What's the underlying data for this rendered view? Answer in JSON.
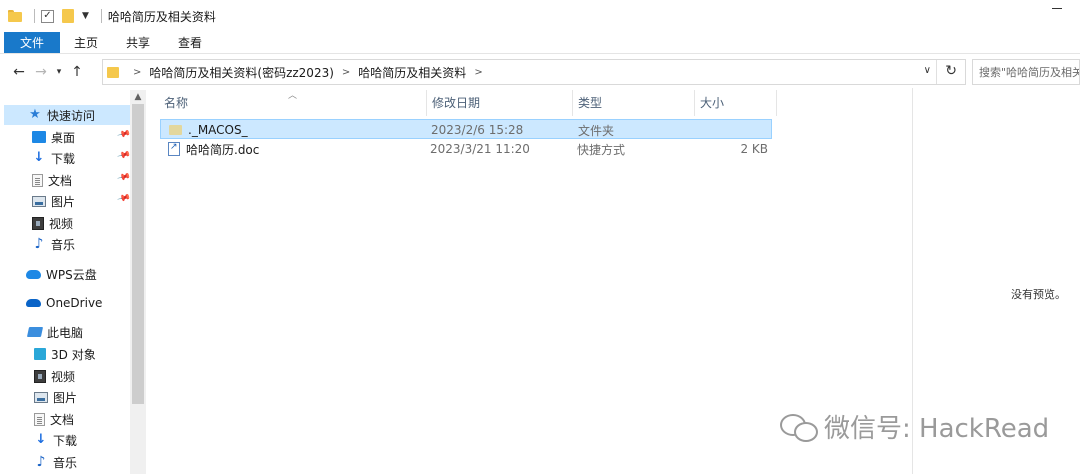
{
  "window": {
    "title": "哈哈简历及相关资料"
  },
  "ribbon": {
    "tabs": [
      "文件",
      "主页",
      "共享",
      "查看"
    ]
  },
  "address": {
    "crumbs": [
      "哈哈简历及相关资料(密码zz2023)",
      "哈哈简历及相关资料"
    ],
    "search_placeholder": "搜索\"哈哈简历及相关资料\""
  },
  "nav": {
    "items": [
      {
        "label": "快速访问",
        "icon": "star-icon"
      },
      {
        "label": "桌面",
        "icon": "desktop-icon"
      },
      {
        "label": "下载",
        "icon": "download-icon"
      },
      {
        "label": "文档",
        "icon": "document-icon"
      },
      {
        "label": "图片",
        "icon": "picture-icon"
      },
      {
        "label": "视频",
        "icon": "video-icon"
      },
      {
        "label": "音乐",
        "icon": "music-icon"
      },
      {
        "label": "WPS云盘",
        "icon": "cloud-icon"
      },
      {
        "label": "OneDrive",
        "icon": "onedrive-icon"
      },
      {
        "label": "此电脑",
        "icon": "computer-icon"
      },
      {
        "label": "3D 对象",
        "icon": "cube-icon"
      },
      {
        "label": "视频",
        "icon": "video-icon"
      },
      {
        "label": "图片",
        "icon": "picture-icon"
      },
      {
        "label": "文档",
        "icon": "document-icon"
      },
      {
        "label": "下载",
        "icon": "download-icon"
      },
      {
        "label": "音乐",
        "icon": "music-icon"
      }
    ]
  },
  "columns": {
    "name": "名称",
    "date": "修改日期",
    "type": "类型",
    "size": "大小"
  },
  "files": [
    {
      "name": "._MACOS_",
      "date": "2023/2/6 15:28",
      "type": "文件夹",
      "size": "",
      "icon": "folder-icon"
    },
    {
      "name": "哈哈简历.doc",
      "date": "2023/3/21 11:20",
      "type": "快捷方式",
      "size": "2 KB",
      "icon": "shortcut-icon"
    }
  ],
  "preview": {
    "empty_text": "没有预览。"
  },
  "watermark": {
    "text": "微信号: HackRead"
  }
}
